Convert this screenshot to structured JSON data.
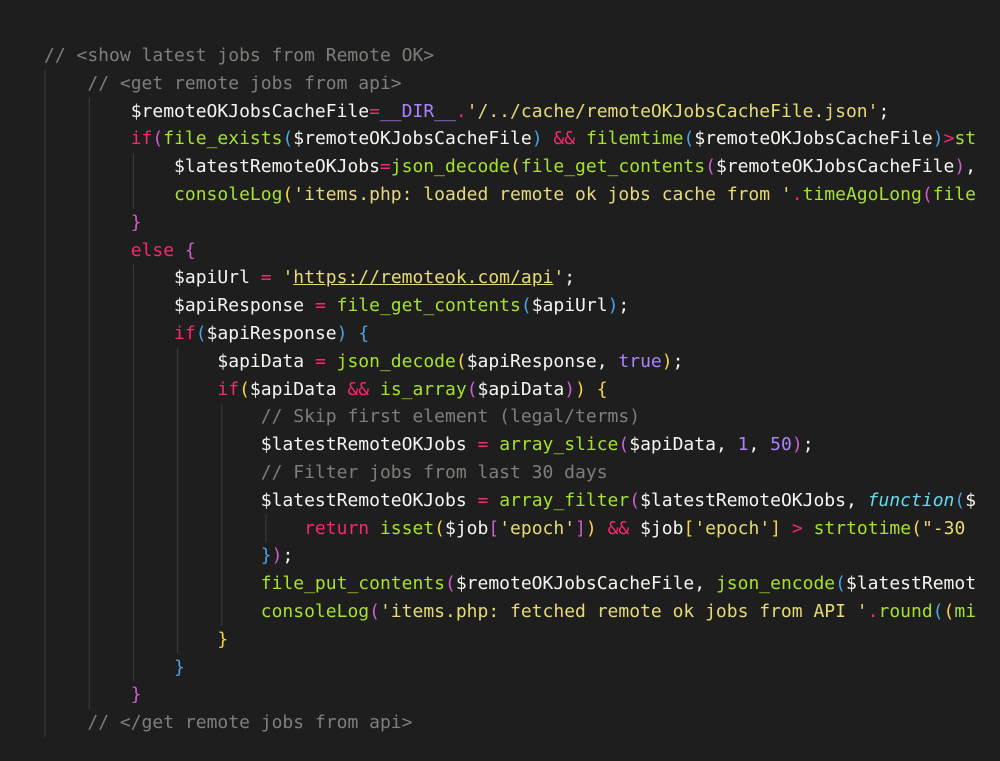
{
  "theme": {
    "background": "#1e1e1e",
    "guide_color": "#3c3c3c",
    "colors": {
      "comment": "#7f7f7a",
      "variable": "#f6f6f0",
      "function": "#a6e22e",
      "keyword": "#f92672",
      "string": "#e6db74",
      "number": "#ae81ff",
      "constant": "#ae81ff",
      "bracket1": "#f9d24b",
      "bracket2": "#cf5ed0",
      "bracket3": "#4ba3e6",
      "operator": "#f92672",
      "punct": "#f6f6f0",
      "storage": "#66d9ef"
    }
  },
  "code": {
    "language": "php",
    "lines": [
      {
        "indent": 0,
        "tokens": [
          {
            "t": "// <show latest jobs from Remote OK>",
            "c": "comment"
          }
        ]
      },
      {
        "indent": 1,
        "tokens": [
          {
            "t": "// <get remote jobs from api>",
            "c": "comment"
          }
        ]
      },
      {
        "indent": 2,
        "tokens": [
          {
            "t": "$remoteOKJobsCacheFile",
            "c": "variable"
          },
          {
            "t": "=",
            "c": "operator"
          },
          {
            "t": "__DIR__",
            "c": "constant"
          },
          {
            "t": ".",
            "c": "operator"
          },
          {
            "t": "'/../cache/remoteOKJobsCacheFile.json'",
            "c": "string"
          },
          {
            "t": ";",
            "c": "punct"
          }
        ]
      },
      {
        "indent": 2,
        "tokens": [
          {
            "t": "if",
            "c": "keyword"
          },
          {
            "t": "(",
            "c": "bracket2"
          },
          {
            "t": "file_exists",
            "c": "function"
          },
          {
            "t": "(",
            "c": "bracket3"
          },
          {
            "t": "$remoteOKJobsCacheFile",
            "c": "variable"
          },
          {
            "t": ") ",
            "c": "bracket3"
          },
          {
            "t": "&&",
            "c": "operator"
          },
          {
            "t": " ",
            "c": "punct"
          },
          {
            "t": "filemtime",
            "c": "function"
          },
          {
            "t": "(",
            "c": "bracket3"
          },
          {
            "t": "$remoteOKJobsCacheFile",
            "c": "variable"
          },
          {
            "t": ")",
            "c": "bracket3"
          },
          {
            "t": ">",
            "c": "operator"
          },
          {
            "t": "st",
            "c": "function"
          }
        ]
      },
      {
        "indent": 3,
        "tokens": [
          {
            "t": "$latestRemoteOKJobs",
            "c": "variable"
          },
          {
            "t": "=",
            "c": "operator"
          },
          {
            "t": "json_decode",
            "c": "function"
          },
          {
            "t": "(",
            "c": "bracket1"
          },
          {
            "t": "file_get_contents",
            "c": "function"
          },
          {
            "t": "(",
            "c": "bracket2"
          },
          {
            "t": "$remoteOKJobsCacheFile",
            "c": "variable"
          },
          {
            "t": ")",
            "c": "bracket2"
          },
          {
            "t": ",",
            "c": "punct"
          }
        ]
      },
      {
        "indent": 3,
        "tokens": [
          {
            "t": "consoleLog",
            "c": "function"
          },
          {
            "t": "(",
            "c": "bracket1"
          },
          {
            "t": "'items.php: loaded remote ok jobs cache from '",
            "c": "string"
          },
          {
            "t": ".",
            "c": "operator"
          },
          {
            "t": "timeAgoLong",
            "c": "function"
          },
          {
            "t": "(",
            "c": "bracket2"
          },
          {
            "t": "file",
            "c": "function"
          }
        ]
      },
      {
        "indent": 2,
        "tokens": [
          {
            "t": "}",
            "c": "bracket2"
          }
        ]
      },
      {
        "indent": 2,
        "tokens": [
          {
            "t": "else",
            "c": "keyword"
          },
          {
            "t": " ",
            "c": "punct"
          },
          {
            "t": "{",
            "c": "bracket2"
          }
        ]
      },
      {
        "indent": 3,
        "tokens": [
          {
            "t": "$apiUrl",
            "c": "variable"
          },
          {
            "t": " ",
            "c": "punct"
          },
          {
            "t": "=",
            "c": "operator"
          },
          {
            "t": " ",
            "c": "punct"
          },
          {
            "t": "'",
            "c": "string"
          },
          {
            "t": "https://remoteok.com/api",
            "c": "string",
            "u": true
          },
          {
            "t": "'",
            "c": "string"
          },
          {
            "t": ";",
            "c": "punct"
          }
        ]
      },
      {
        "indent": 3,
        "tokens": [
          {
            "t": "$apiResponse",
            "c": "variable"
          },
          {
            "t": " ",
            "c": "punct"
          },
          {
            "t": "=",
            "c": "operator"
          },
          {
            "t": " ",
            "c": "punct"
          },
          {
            "t": "file_get_contents",
            "c": "function"
          },
          {
            "t": "(",
            "c": "bracket3"
          },
          {
            "t": "$apiUrl",
            "c": "variable"
          },
          {
            "t": ")",
            "c": "bracket3"
          },
          {
            "t": ";",
            "c": "punct"
          }
        ]
      },
      {
        "indent": 3,
        "tokens": [
          {
            "t": "if",
            "c": "keyword"
          },
          {
            "t": "(",
            "c": "bracket3"
          },
          {
            "t": "$apiResponse",
            "c": "variable"
          },
          {
            "t": ")",
            "c": "bracket3"
          },
          {
            "t": " ",
            "c": "punct"
          },
          {
            "t": "{",
            "c": "bracket3"
          }
        ]
      },
      {
        "indent": 4,
        "tokens": [
          {
            "t": "$apiData",
            "c": "variable"
          },
          {
            "t": " ",
            "c": "punct"
          },
          {
            "t": "=",
            "c": "operator"
          },
          {
            "t": " ",
            "c": "punct"
          },
          {
            "t": "json_decode",
            "c": "function"
          },
          {
            "t": "(",
            "c": "bracket1"
          },
          {
            "t": "$apiResponse",
            "c": "variable"
          },
          {
            "t": ", ",
            "c": "punct"
          },
          {
            "t": "true",
            "c": "constant"
          },
          {
            "t": ")",
            "c": "bracket1"
          },
          {
            "t": ";",
            "c": "punct"
          }
        ]
      },
      {
        "indent": 4,
        "tokens": [
          {
            "t": "if",
            "c": "keyword"
          },
          {
            "t": "(",
            "c": "bracket1"
          },
          {
            "t": "$apiData",
            "c": "variable"
          },
          {
            "t": " ",
            "c": "punct"
          },
          {
            "t": "&&",
            "c": "operator"
          },
          {
            "t": " ",
            "c": "punct"
          },
          {
            "t": "is_array",
            "c": "function"
          },
          {
            "t": "(",
            "c": "bracket2"
          },
          {
            "t": "$apiData",
            "c": "variable"
          },
          {
            "t": ")",
            "c": "bracket2"
          },
          {
            "t": ")",
            "c": "bracket1"
          },
          {
            "t": " ",
            "c": "punct"
          },
          {
            "t": "{",
            "c": "bracket1"
          }
        ]
      },
      {
        "indent": 5,
        "tokens": [
          {
            "t": "// Skip first element (legal/terms)",
            "c": "comment"
          }
        ]
      },
      {
        "indent": 5,
        "tokens": [
          {
            "t": "$latestRemoteOKJobs",
            "c": "variable"
          },
          {
            "t": " ",
            "c": "punct"
          },
          {
            "t": "=",
            "c": "operator"
          },
          {
            "t": " ",
            "c": "punct"
          },
          {
            "t": "array_slice",
            "c": "function"
          },
          {
            "t": "(",
            "c": "bracket2"
          },
          {
            "t": "$apiData",
            "c": "variable"
          },
          {
            "t": ", ",
            "c": "punct"
          },
          {
            "t": "1",
            "c": "number"
          },
          {
            "t": ", ",
            "c": "punct"
          },
          {
            "t": "50",
            "c": "number"
          },
          {
            "t": ")",
            "c": "bracket2"
          },
          {
            "t": ";",
            "c": "punct"
          }
        ]
      },
      {
        "indent": 5,
        "tokens": [
          {
            "t": "// Filter jobs from last 30 days",
            "c": "comment"
          }
        ]
      },
      {
        "indent": 5,
        "tokens": [
          {
            "t": "$latestRemoteOKJobs",
            "c": "variable"
          },
          {
            "t": " ",
            "c": "punct"
          },
          {
            "t": "=",
            "c": "operator"
          },
          {
            "t": " ",
            "c": "punct"
          },
          {
            "t": "array_filter",
            "c": "function"
          },
          {
            "t": "(",
            "c": "bracket2"
          },
          {
            "t": "$latestRemoteOKJobs",
            "c": "variable"
          },
          {
            "t": ", ",
            "c": "punct"
          },
          {
            "t": "function",
            "c": "storage",
            "i": true
          },
          {
            "t": "(",
            "c": "bracket3"
          },
          {
            "t": "$",
            "c": "variable"
          }
        ]
      },
      {
        "indent": 6,
        "tokens": [
          {
            "t": "return",
            "c": "keyword"
          },
          {
            "t": " ",
            "c": "punct"
          },
          {
            "t": "isset",
            "c": "function"
          },
          {
            "t": "(",
            "c": "bracket1"
          },
          {
            "t": "$job",
            "c": "variable"
          },
          {
            "t": "[",
            "c": "bracket2"
          },
          {
            "t": "'epoch'",
            "c": "string"
          },
          {
            "t": "]",
            "c": "bracket2"
          },
          {
            "t": ")",
            "c": "bracket1"
          },
          {
            "t": " ",
            "c": "punct"
          },
          {
            "t": "&&",
            "c": "operator"
          },
          {
            "t": " ",
            "c": "punct"
          },
          {
            "t": "$job",
            "c": "variable"
          },
          {
            "t": "[",
            "c": "bracket1"
          },
          {
            "t": "'epoch'",
            "c": "string"
          },
          {
            "t": "]",
            "c": "bracket1"
          },
          {
            "t": " ",
            "c": "punct"
          },
          {
            "t": ">",
            "c": "operator"
          },
          {
            "t": " ",
            "c": "punct"
          },
          {
            "t": "strtotime",
            "c": "function"
          },
          {
            "t": "(",
            "c": "bracket1"
          },
          {
            "t": "\"-30",
            "c": "string"
          }
        ]
      },
      {
        "indent": 5,
        "tokens": [
          {
            "t": "}",
            "c": "bracket3"
          },
          {
            "t": ")",
            "c": "bracket2"
          },
          {
            "t": ";",
            "c": "punct"
          }
        ]
      },
      {
        "indent": 5,
        "tokens": [
          {
            "t": "file_put_contents",
            "c": "function"
          },
          {
            "t": "(",
            "c": "bracket2"
          },
          {
            "t": "$remoteOKJobsCacheFile",
            "c": "variable"
          },
          {
            "t": ", ",
            "c": "punct"
          },
          {
            "t": "json_encode",
            "c": "function"
          },
          {
            "t": "(",
            "c": "bracket3"
          },
          {
            "t": "$latestRemot",
            "c": "variable"
          }
        ]
      },
      {
        "indent": 5,
        "tokens": [
          {
            "t": "consoleLog",
            "c": "function"
          },
          {
            "t": "(",
            "c": "bracket2"
          },
          {
            "t": "'items.php: fetched remote ok jobs from API '",
            "c": "string"
          },
          {
            "t": ".",
            "c": "operator"
          },
          {
            "t": "round",
            "c": "function"
          },
          {
            "t": "(",
            "c": "bracket3"
          },
          {
            "t": "(",
            "c": "bracket1"
          },
          {
            "t": "mi",
            "c": "function"
          }
        ]
      },
      {
        "indent": 4,
        "tokens": [
          {
            "t": "}",
            "c": "bracket1"
          }
        ]
      },
      {
        "indent": 3,
        "tokens": [
          {
            "t": "}",
            "c": "bracket3"
          }
        ]
      },
      {
        "indent": 2,
        "tokens": [
          {
            "t": "}",
            "c": "bracket2"
          }
        ]
      },
      {
        "indent": 1,
        "tokens": [
          {
            "t": "// </get remote jobs from api>",
            "c": "comment"
          }
        ]
      }
    ]
  }
}
